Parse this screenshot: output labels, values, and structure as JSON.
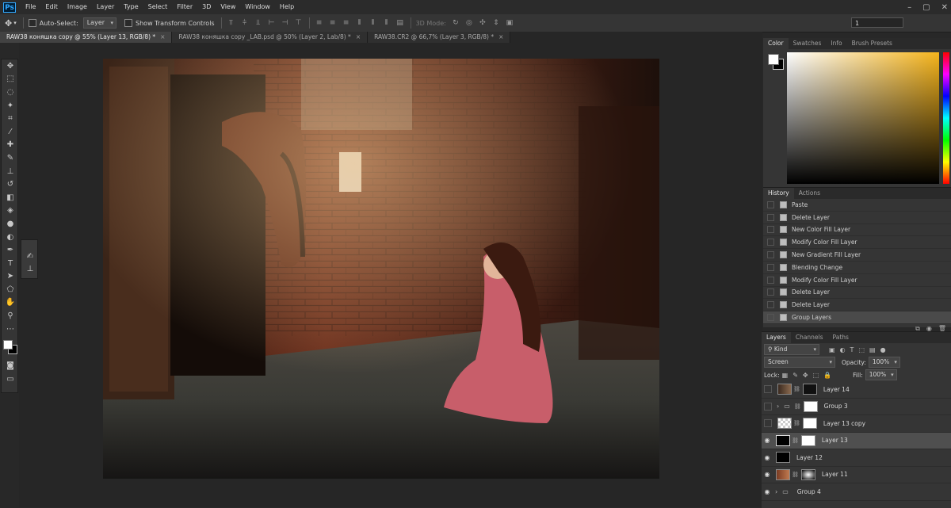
{
  "menu": {
    "app_icon": "Ps",
    "items": [
      "File",
      "Edit",
      "Image",
      "Layer",
      "Type",
      "Select",
      "Filter",
      "3D",
      "View",
      "Window",
      "Help"
    ],
    "window_controls": [
      "minimize-icon",
      "maximize-icon",
      "close-icon"
    ]
  },
  "options_bar": {
    "auto_select_label": "Auto-Select:",
    "auto_select_value": "Layer",
    "show_transform_label": "Show Transform Controls",
    "mode_3d_label": "3D Mode:",
    "field_value": "1"
  },
  "tabs": [
    {
      "label": "RAW38 коняшка copy @ 55% (Layer 13, RGB/8) *",
      "close": "×"
    },
    {
      "label": "RAW38 коняшка copy _LAB.psd @ 50% (Layer 2, Lab/8) *",
      "close": "×"
    },
    {
      "label": "RAW38.CR2 @ 66,7% (Layer 3, RGB/8) *",
      "close": "×"
    }
  ],
  "color_panel": {
    "tabs": [
      "Color",
      "Swatches",
      "Info",
      "Brush Presets"
    ],
    "hue_color": "#f5b41c"
  },
  "history_panel": {
    "tabs": [
      "History",
      "Actions"
    ],
    "items": [
      "Paste",
      "Delete Layer",
      "New Color Fill Layer",
      "Modify Color Fill Layer",
      "New Gradient Fill Layer",
      "Blending Change",
      "Modify Color Fill Layer",
      "Delete Layer",
      "Delete Layer",
      "Group Layers"
    ]
  },
  "layers_panel": {
    "tabs": [
      "Layers",
      "Channels",
      "Paths"
    ],
    "kind_label": "Kind",
    "blend_mode": "Screen",
    "opacity_label": "Opacity:",
    "opacity_value": "100%",
    "lock_label": "Lock:",
    "fill_label": "Fill:",
    "fill_value": "100%",
    "layers": [
      {
        "name": "Layer 14",
        "visible": false
      },
      {
        "name": "Group 3",
        "visible": false
      },
      {
        "name": "Layer 13 copy",
        "visible": false
      },
      {
        "name": "Layer 13",
        "visible": true
      },
      {
        "name": "Layer 12",
        "visible": true
      },
      {
        "name": "Layer 11",
        "visible": true
      },
      {
        "name": "Group 4",
        "visible": true
      }
    ]
  }
}
